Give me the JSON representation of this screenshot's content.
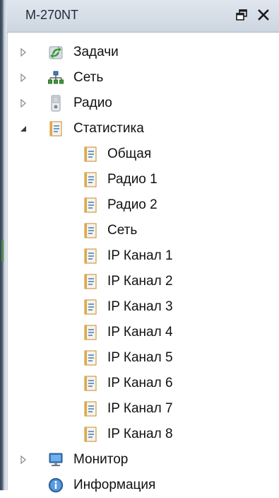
{
  "panel": {
    "title": "M-270NT",
    "float_icon": "float-window-icon",
    "close_icon": "close-icon"
  },
  "tree": {
    "items": [
      {
        "label": "Задачи",
        "icon": "tasks-icon",
        "expander": "collapsed"
      },
      {
        "label": "Сеть",
        "icon": "network-icon",
        "expander": "collapsed"
      },
      {
        "label": "Радио",
        "icon": "radio-device-icon",
        "expander": "collapsed"
      },
      {
        "label": "Статистика",
        "icon": "statistics-icon",
        "expander": "expanded",
        "children": [
          {
            "label": "Общая"
          },
          {
            "label": "Радио 1"
          },
          {
            "label": "Радио 2"
          },
          {
            "label": "Сеть"
          },
          {
            "label": "IP Канал 1"
          },
          {
            "label": "IP Канал 2"
          },
          {
            "label": "IP Канал 3"
          },
          {
            "label": "IP Канал 4"
          },
          {
            "label": "IP Канал 5"
          },
          {
            "label": "IP Канал 6"
          },
          {
            "label": "IP Канал 7"
          },
          {
            "label": "IP Канал 8"
          }
        ]
      },
      {
        "label": "Монитор",
        "icon": "monitor-icon",
        "expander": "collapsed"
      },
      {
        "label": "Информация",
        "icon": "info-icon",
        "expander": "none"
      }
    ]
  },
  "colors": {
    "titlebar": "#cdd6e0",
    "background": "#ffffff",
    "text": "#111111"
  }
}
